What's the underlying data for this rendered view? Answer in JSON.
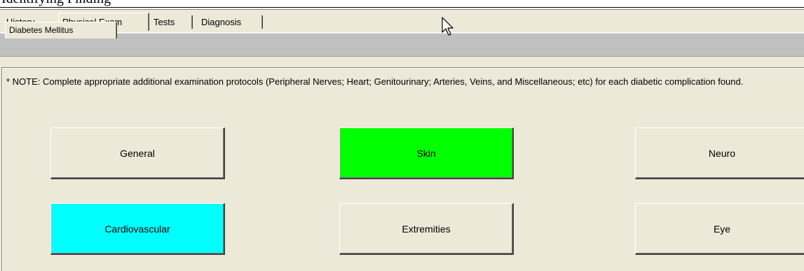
{
  "top_clipped_text": "Identifying Finding",
  "tabs": [
    {
      "label": "History"
    },
    {
      "label": "Physical Exam",
      "active": true
    },
    {
      "label": "Tests"
    },
    {
      "label": "Diagnosis"
    }
  ],
  "subtab": {
    "label": "Diabetes Mellitus"
  },
  "note": "* NOTE: Complete appropriate additional examination protocols (Peripheral Nerves; Heart; Genitourinary; Arteries, Veins, and Miscellaneous; etc) for each diabetic complication found.",
  "buttons": {
    "general": {
      "label": "General",
      "color": "#ece9d8"
    },
    "skin": {
      "label": "Skin",
      "color": "#00ff00"
    },
    "neuro": {
      "label": "Neuro",
      "color": "#ece9d8"
    },
    "cardiovascular": {
      "label": "Cardiovascular",
      "color": "#00ffff"
    },
    "extremities": {
      "label": "Extremities",
      "color": "#ece9d8"
    },
    "eye": {
      "label": "Eye",
      "color": "#ece9d8"
    }
  },
  "colors": {
    "window_bg": "#ece9d8",
    "subbar_bg": "#c0c0c0",
    "skin_highlight": "#00ff00",
    "cardio_highlight": "#00ffff"
  },
  "icons": {
    "cursor": "mouse-pointer-icon"
  }
}
